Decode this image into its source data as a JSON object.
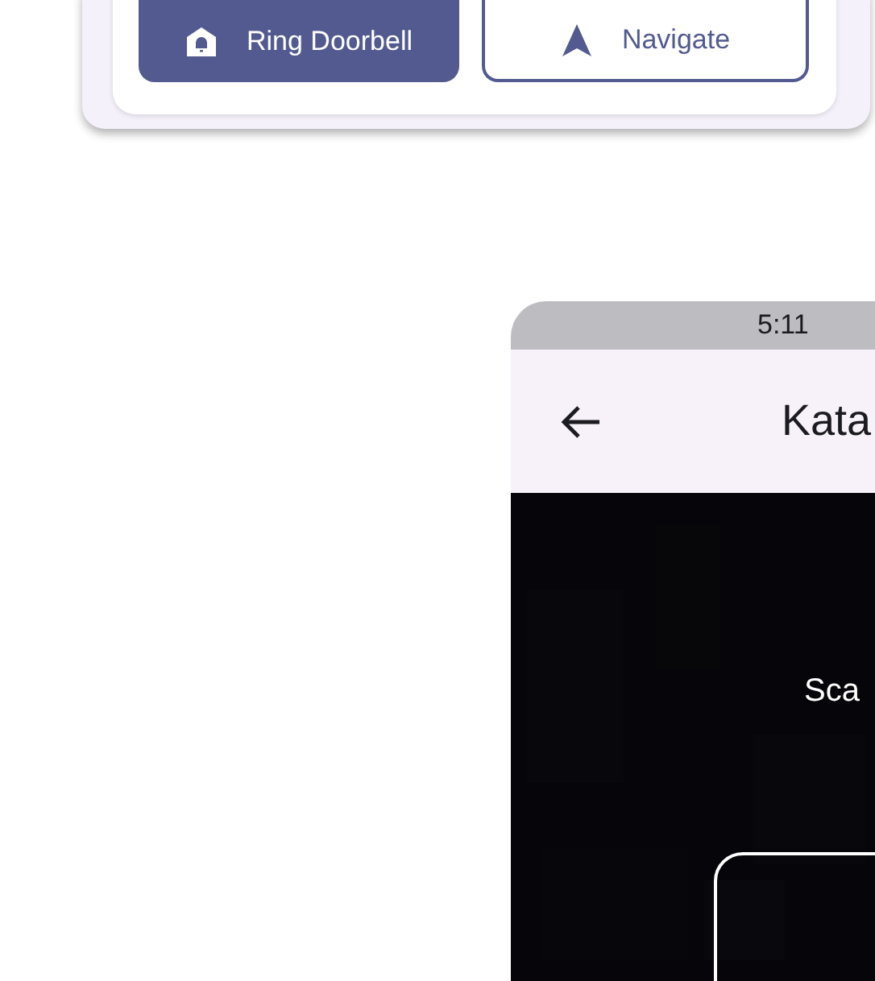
{
  "card": {
    "buttons": [
      {
        "label": "Ring Doorbell",
        "kind": "filled"
      },
      {
        "label": "Navigate",
        "kind": "outlined"
      }
    ]
  },
  "phone": {
    "status_bar": {
      "time": "5:11"
    },
    "app_bar": {
      "title": "Kata"
    },
    "camera": {
      "kind": "picture",
      "prompt": "Sca"
    }
  }
}
